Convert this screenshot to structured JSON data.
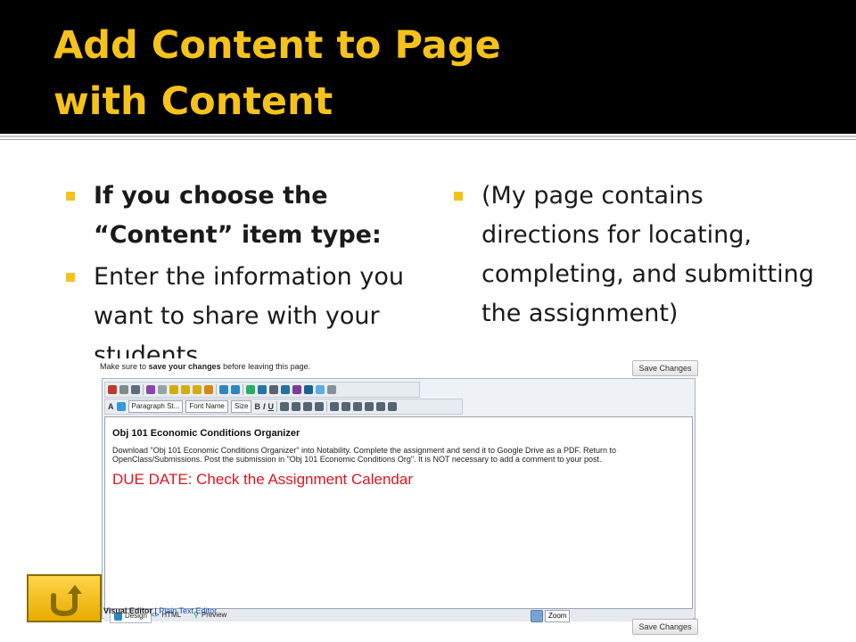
{
  "slide": {
    "title_line1": "Add Content to Page",
    "title_line2": "with Content"
  },
  "bullets_left": [
    {
      "text": "If you choose the “Content” item type:",
      "bold": true
    },
    {
      "text": "Enter the information you want to share with your students",
      "bold": false
    }
  ],
  "bullets_right": [
    {
      "text": "(My page contains directions for locating, completing, and submitting the assignment)",
      "bold": false
    }
  ],
  "editor": {
    "note_prefix": "Make sure to ",
    "note_bold": "save your changes",
    "note_suffix": " before leaving this page.",
    "save_top": "Save Changes",
    "save_bottom": "Save Changes",
    "paragraph_style": "Paragraph St...",
    "font_name": "Font Name",
    "size": "Size",
    "bold_label": "B",
    "italic_label": "I",
    "underline_label": "U",
    "content_title": "Obj 101 Economic Conditions Organizer",
    "content_body": "Download \"Obj 101 Economic Conditions Organizer\" into Notability. Complete the assignment and send it to Google Drive as a PDF. Return to OpenClass/Submissions. Post the submission in \"Obj 101 Economic Conditions Org\". It is NOT necessary to add a comment to your post.",
    "due_date": "DUE DATE: Check the Assignment Calendar",
    "mode_design": "Design",
    "mode_html": "HTML",
    "mode_preview": "Preview",
    "zoom": "Zoom",
    "visual_editor": "Visual Editor",
    "separator": " | ",
    "plain_text_editor": "Plain Text Editor"
  },
  "colors": {
    "accent": "#f4c21b",
    "title_bg": "#000000",
    "due_red": "#e0141e"
  },
  "icons": {
    "home_button": "u-turn-arrow-icon"
  }
}
